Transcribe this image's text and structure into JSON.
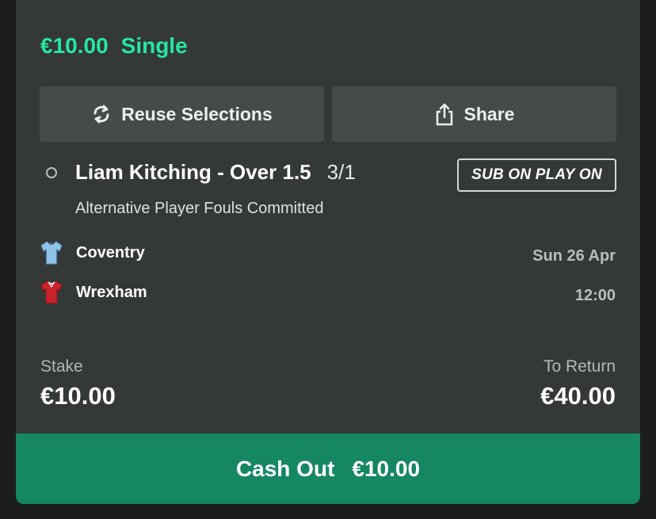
{
  "bet": {
    "stake_amount": "€10.00",
    "bet_type": "Single"
  },
  "actions": {
    "reuse_label": "Reuse Selections",
    "share_label": "Share"
  },
  "selection": {
    "name": "Liam Kitching - Over 1.5",
    "odds": "3/1",
    "badge": "SUB ON PLAY ON",
    "market": "Alternative Player Fouls Committed"
  },
  "event": {
    "home_team": "Coventry",
    "away_team": "Wrexham",
    "date": "Sun 26 Apr",
    "time": "12:00"
  },
  "summary": {
    "stake_label": "Stake",
    "stake_value": "€10.00",
    "return_label": "To Return",
    "return_value": "€40.00"
  },
  "cashout": {
    "label": "Cash Out",
    "value": "€10.00"
  },
  "icons": {
    "reuse": "refresh-icon",
    "share": "share-icon",
    "home_kit": "shirt-icon",
    "away_kit": "shirt-icon"
  },
  "colors": {
    "accent_green": "#27e6a0",
    "cashout_bg": "#158762",
    "card_bg": "#343836"
  }
}
